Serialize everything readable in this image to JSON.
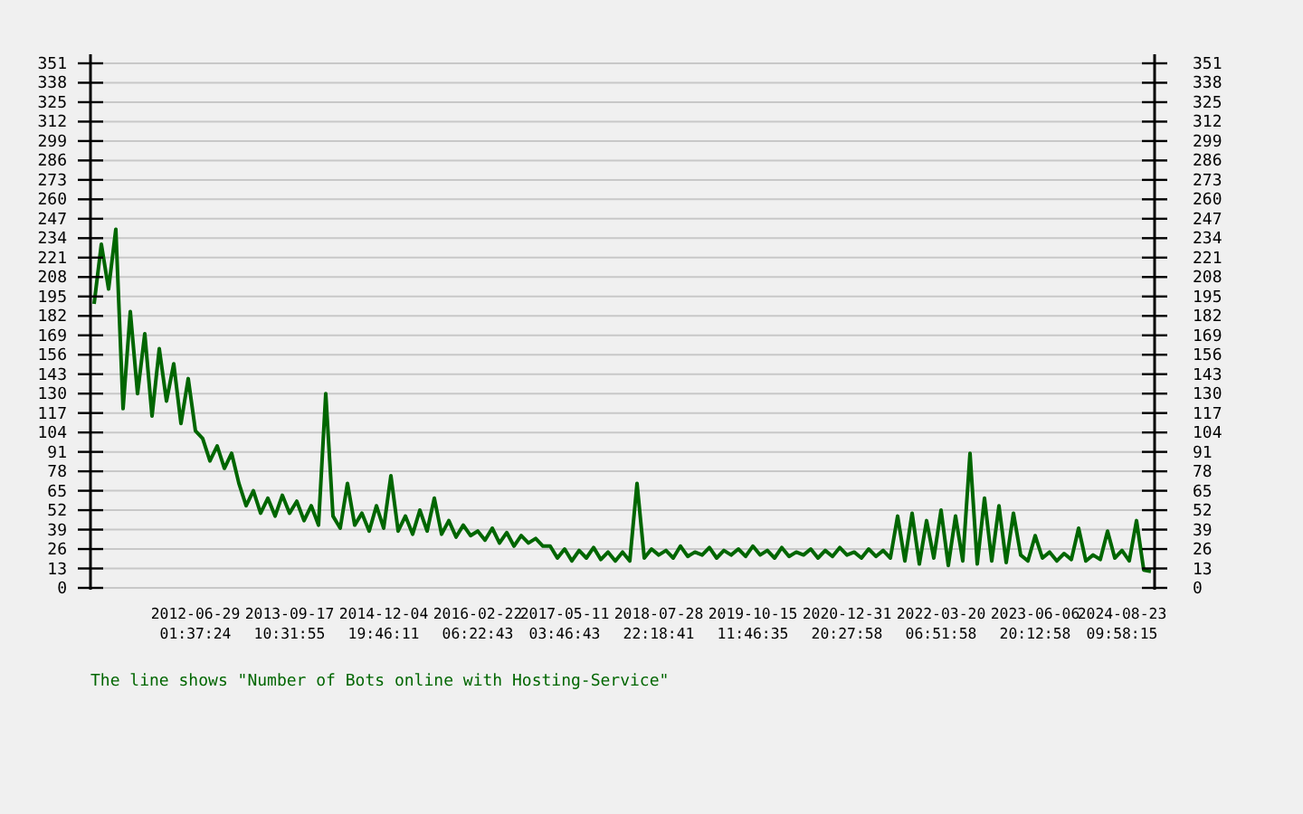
{
  "chart": {
    "chart_data": {
      "type": "line",
      "categories": [
        null,
        null,
        null,
        null,
        null,
        null,
        null,
        null,
        null,
        null,
        null,
        null,
        null,
        null,
        "2012-06-29 01:37:24",
        null,
        null,
        null,
        null,
        null,
        null,
        null,
        null,
        null,
        null,
        null,
        null,
        "2013-09-17 10:31:55",
        null,
        null,
        null,
        null,
        null,
        null,
        null,
        null,
        null,
        null,
        null,
        null,
        "2014-12-04 19:46:11",
        null,
        null,
        null,
        null,
        null,
        null,
        null,
        null,
        null,
        null,
        null,
        null,
        "2016-02-22 06:22:43",
        null,
        null,
        null,
        null,
        null,
        null,
        null,
        null,
        null,
        null,
        null,
        "2017-05-11 03:46:43",
        null,
        null,
        null,
        null,
        null,
        null,
        null,
        null,
        null,
        null,
        null,
        null,
        "2018-07-28 22:18:41",
        null,
        null,
        null,
        null,
        null,
        null,
        null,
        null,
        null,
        null,
        null,
        null,
        "2019-10-15 11:46:35",
        null,
        null,
        null,
        null,
        null,
        null,
        null,
        null,
        null,
        null,
        null,
        null,
        "2020-12-31 20:27:58",
        null,
        null,
        null,
        null,
        null,
        null,
        null,
        null,
        null,
        null,
        null,
        null,
        "2022-03-20 06:51:58",
        null,
        null,
        null,
        null,
        null,
        null,
        null,
        null,
        null,
        null,
        null,
        null,
        "2023-06-06 20:12:58",
        null,
        null,
        null,
        null,
        null,
        null,
        null,
        null,
        null,
        null,
        null,
        "2024-08-23 09:58:15",
        null,
        null,
        null,
        null
      ],
      "series": [
        {
          "color": "#006600",
          "values": [
            190,
            230,
            200,
            240,
            120,
            185,
            130,
            170,
            115,
            160,
            125,
            150,
            110,
            140,
            105,
            100,
            85,
            95,
            80,
            90,
            70,
            55,
            65,
            50,
            60,
            48,
            62,
            50,
            58,
            45,
            55,
            42,
            130,
            48,
            40,
            70,
            42,
            50,
            38,
            55,
            40,
            75,
            38,
            48,
            36,
            52,
            38,
            60,
            36,
            45,
            34,
            42,
            35,
            38,
            32,
            40,
            30,
            37,
            28,
            35,
            30,
            33,
            28,
            28,
            20,
            26,
            18,
            25,
            20,
            27,
            19,
            24,
            18,
            24,
            18,
            70,
            20,
            26,
            22,
            25,
            20,
            28,
            21,
            24,
            22,
            27,
            20,
            25,
            22,
            26,
            21,
            28,
            22,
            25,
            20,
            27,
            21,
            24,
            22,
            26,
            20,
            25,
            21,
            27,
            22,
            24,
            20,
            26,
            21,
            25,
            20,
            48,
            18,
            50,
            16,
            45,
            20,
            52,
            15,
            48,
            18,
            90,
            16,
            60,
            18,
            55,
            17,
            50,
            22,
            18,
            35,
            20,
            24,
            18,
            23,
            19,
            40,
            18,
            22,
            19,
            38,
            20,
            25,
            18,
            45,
            12,
            11
          ]
        }
      ],
      "grid": true,
      "ylim": [
        0,
        351
      ],
      "y2lim": [
        0,
        351
      ],
      "y2ticks": [
        0,
        13,
        26,
        39,
        52,
        65,
        78,
        91,
        104,
        117,
        130,
        143,
        156,
        169,
        182,
        195,
        208,
        221,
        234,
        247,
        260,
        273,
        286,
        299,
        312,
        325,
        338,
        351
      ],
      "yticks": [
        0,
        13,
        26,
        39,
        52,
        65,
        78,
        91,
        104,
        117,
        130,
        143,
        156,
        169,
        182,
        195,
        208,
        221,
        234,
        247,
        260,
        273,
        286,
        299,
        312,
        325,
        338,
        351
      ]
    }
  },
  "caption": "The line shows \"Number of Bots online with Hosting-Service\""
}
